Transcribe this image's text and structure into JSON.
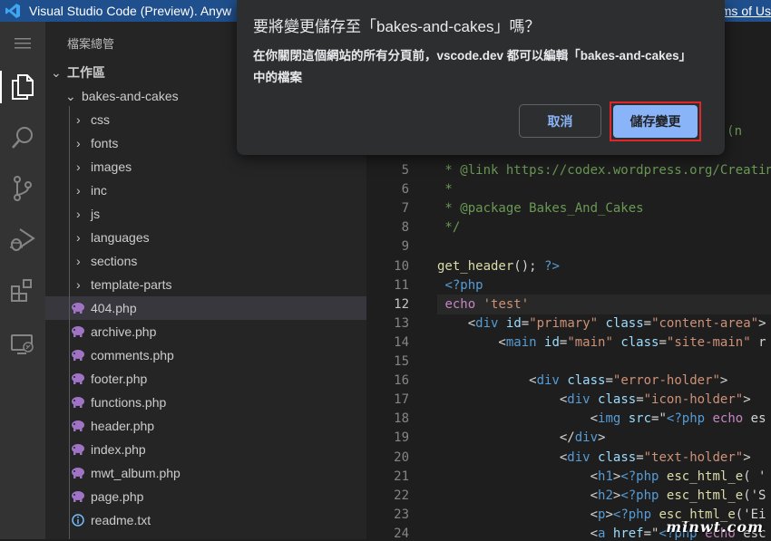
{
  "window": {
    "title": "Visual Studio Code (Preview). Anyw",
    "terms_link": "rms of Us"
  },
  "activity_bar": {
    "items": [
      "menu-icon",
      "explorer-icon",
      "search-icon",
      "source-control-icon",
      "run-debug-icon",
      "extensions-icon",
      "remote-explorer-icon"
    ]
  },
  "sidebar": {
    "title": "檔案總管",
    "workspace": "工作區",
    "root_folder": "bakes-and-cakes",
    "folders": [
      "css",
      "fonts",
      "images",
      "inc",
      "js",
      "languages",
      "sections",
      "template-parts"
    ],
    "files": [
      {
        "name": "404.php",
        "icon": "php-icon",
        "selected": true
      },
      {
        "name": "archive.php",
        "icon": "php-icon"
      },
      {
        "name": "comments.php",
        "icon": "php-icon"
      },
      {
        "name": "footer.php",
        "icon": "php-icon"
      },
      {
        "name": "functions.php",
        "icon": "php-icon"
      },
      {
        "name": "header.php",
        "icon": "php-icon"
      },
      {
        "name": "index.php",
        "icon": "php-icon"
      },
      {
        "name": "mwt_album.php",
        "icon": "php-icon"
      },
      {
        "name": "page.php",
        "icon": "php-icon"
      },
      {
        "name": "readme.txt",
        "icon": "info-icon"
      }
    ]
  },
  "editor": {
    "current_line": 12,
    "fragment_top": "ages (n",
    "lines": [
      {
        "n": "5",
        "text": " * @link https://codex.wordpress.org/Creatin"
      },
      {
        "n": "6",
        "text": " *"
      },
      {
        "n": "7",
        "text": " * @package Bakes_And_Cakes"
      },
      {
        "n": "8",
        "text": " */"
      },
      {
        "n": "9",
        "text": ""
      },
      {
        "n": "10",
        "text": "get_header(); ?>"
      },
      {
        "n": "11",
        "text": " <?php"
      },
      {
        "n": "12",
        "text": " echo 'test'"
      },
      {
        "n": "13",
        "text": "    <div id=\"primary\" class=\"content-area\">"
      },
      {
        "n": "14",
        "text": "        <main id=\"main\" class=\"site-main\" r"
      },
      {
        "n": "15",
        "text": ""
      },
      {
        "n": "16",
        "text": "            <div class=\"error-holder\">"
      },
      {
        "n": "17",
        "text": "                <div class=\"icon-holder\">"
      },
      {
        "n": "18",
        "text": "                    <img src=\"<?php echo es"
      },
      {
        "n": "19",
        "text": "                </div>"
      },
      {
        "n": "20",
        "text": "                <div class=\"text-holder\">"
      },
      {
        "n": "21",
        "text": "                    <h1><?php esc_html_e( '"
      },
      {
        "n": "22",
        "text": "                    <h2><?php esc_html_e('S"
      },
      {
        "n": "23",
        "text": "                    <p><?php esc_html_e('Ei"
      },
      {
        "n": "24",
        "text": "                    <a href=\"<?php echo esc"
      }
    ]
  },
  "dialog": {
    "title": "要將變更儲存至「bakes-and-cakes」嗎？",
    "body": "在你關閉這個網站的所有分頁前，vscode.dev 都可以編輯「bakes-and-cakes」中的檔案",
    "cancel_label": "取消",
    "save_label": "儲存變更"
  },
  "watermark": "minwt.com",
  "colors": {
    "title_bar": "#1f4f8c",
    "activity_bar": "#333333",
    "sidebar": "#252526",
    "editor": "#1e1e1e",
    "dialog": "#2d2e30",
    "save_button": "#8ab4f8",
    "highlight_box": "#e0252b",
    "php_icon": "#a074c4"
  }
}
